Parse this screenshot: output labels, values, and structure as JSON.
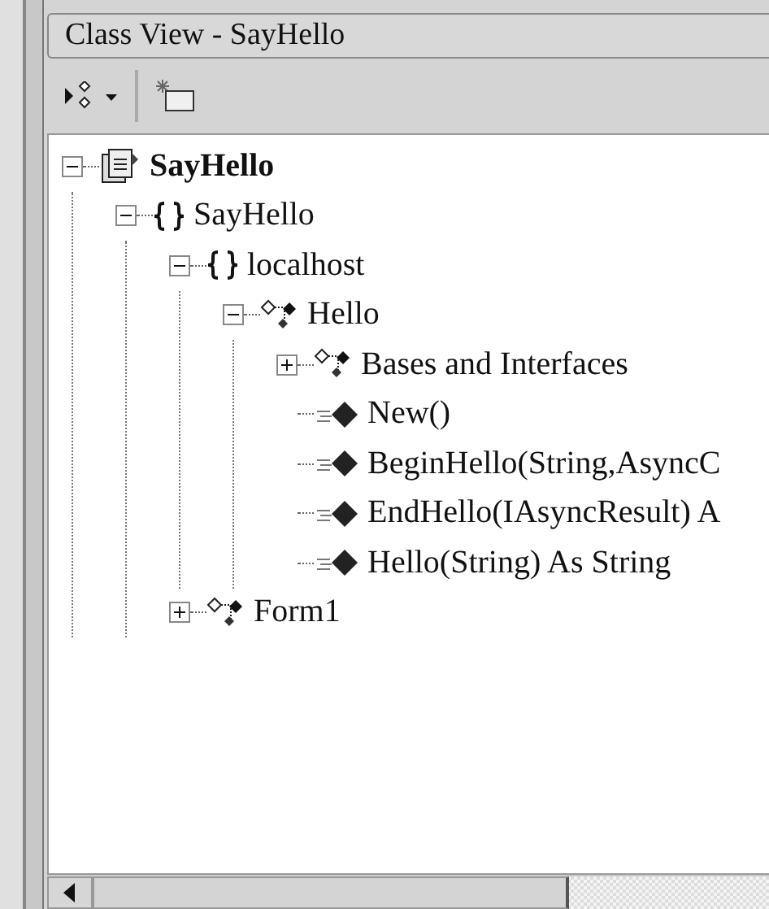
{
  "window": {
    "title": "Class View - SayHello"
  },
  "tree": [
    {
      "label": "SayHello",
      "kind": "project",
      "expanded": true,
      "children": [
        {
          "label": "SayHello",
          "kind": "namespace",
          "expanded": true,
          "children": [
            {
              "label": "localhost",
              "kind": "namespace",
              "expanded": true,
              "children": [
                {
                  "label": "Hello",
                  "kind": "class",
                  "expanded": true,
                  "children": [
                    {
                      "label": "Bases and Interfaces",
                      "kind": "class",
                      "expanded": false
                    },
                    {
                      "label": "New()",
                      "kind": "method"
                    },
                    {
                      "label": "BeginHello(String,AsyncC",
                      "kind": "method"
                    },
                    {
                      "label": "EndHello(IAsyncResult) A",
                      "kind": "method"
                    },
                    {
                      "label": "Hello(String) As String",
                      "kind": "method"
                    }
                  ]
                }
              ]
            },
            {
              "label": "Form1",
              "kind": "class",
              "expanded": false
            }
          ]
        }
      ]
    }
  ]
}
